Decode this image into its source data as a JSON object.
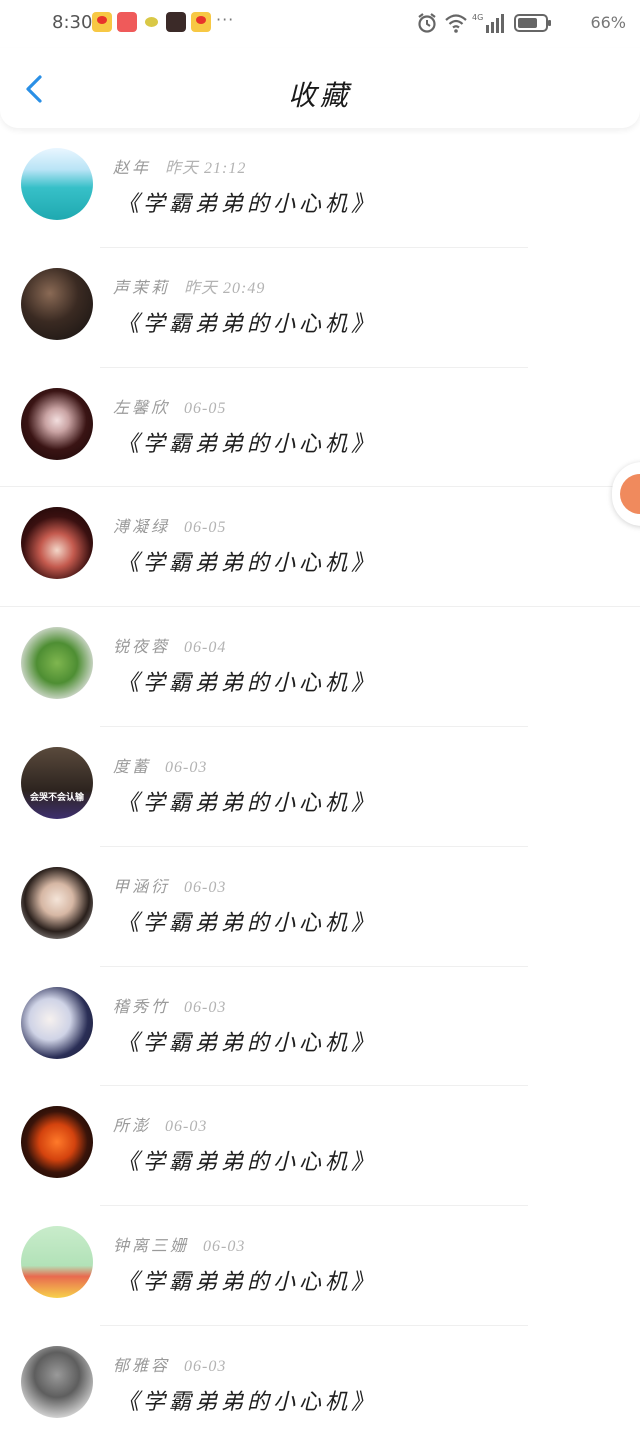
{
  "status_bar": {
    "time": "8:30",
    "network": "4G",
    "battery": "66%",
    "more": "···"
  },
  "header": {
    "title": "收藏"
  },
  "colors": {
    "accent": "#2a8fe6",
    "meta_text": "#9a9a9a",
    "title_text": "#1f1f1f"
  },
  "items": [
    {
      "author": "赵年",
      "date": "昨天 21:12",
      "title": "《学霸弟弟的小心机》",
      "avatar": "sea"
    },
    {
      "author": "声茉莉",
      "date": "昨天 20:49",
      "title": "《学霸弟弟的小心机》",
      "avatar": "dark"
    },
    {
      "author": "左馨欣",
      "date": "06-05",
      "title": "《学霸弟弟的小心机》",
      "avatar": "gothic"
    },
    {
      "author": "溥凝绿",
      "date": "06-05",
      "title": "《学霸弟弟的小心机》",
      "avatar": "anime"
    },
    {
      "author": "锐夜蓉",
      "date": "06-04",
      "title": "《学霸弟弟的小心机》",
      "avatar": "fern"
    },
    {
      "author": "度蓄",
      "date": "06-03",
      "title": "《学霸弟弟的小心机》",
      "avatar": "video",
      "avatar_caption": "会哭不会认输"
    },
    {
      "author": "甲涵衍",
      "date": "06-03",
      "title": "《学霸弟弟的小心机》",
      "avatar": "girl"
    },
    {
      "author": "稽秀竹",
      "date": "06-03",
      "title": "《学霸弟弟的小心机》",
      "avatar": "boy"
    },
    {
      "author": "所澎",
      "date": "06-03",
      "title": "《学霸弟弟的小心机》",
      "avatar": "pine"
    },
    {
      "author": "钟离三姗",
      "date": "06-03",
      "title": "《学霸弟弟的小心机》",
      "avatar": "shin"
    },
    {
      "author": "郁雅容",
      "date": "06-03",
      "title": "《学霸弟弟的小心机》",
      "avatar": "lion"
    }
  ]
}
